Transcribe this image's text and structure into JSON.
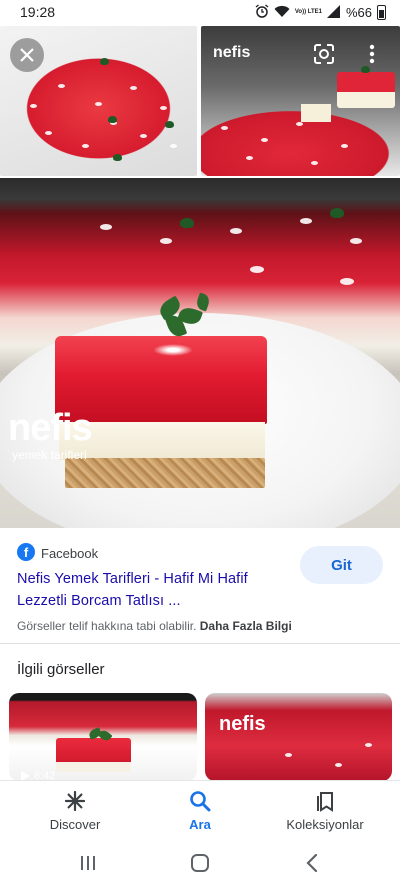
{
  "status_bar": {
    "time": "19:28",
    "network": "Vo)) LTE1",
    "battery": "%66"
  },
  "viewer": {
    "close_icon": "close-icon",
    "lens_icon": "google-lens-icon",
    "more_icon": "more-vert-icon",
    "watermark_brand": "nefis",
    "watermark_sub": "yemek tarifleri",
    "thumb_watermark": "nefis"
  },
  "result": {
    "source_name": "Facebook",
    "source_icon": "facebook-icon",
    "title": "Nefis Yemek Tarifleri - Hafif Mi Hafif Lezzetli Borcam Tatlısı ...",
    "visit_button": "Git",
    "copyright_text": "Görseller telif hakkına tabi olabilir.",
    "more_info_link": "Daha Fazla Bilgi"
  },
  "related": {
    "heading": "İlgili görseller",
    "items": [
      {
        "duration": "6:42",
        "icon": "play-icon"
      },
      {
        "watermark": "nefis"
      }
    ]
  },
  "bottom_nav": {
    "items": [
      {
        "label": "Discover",
        "icon": "discover-asterisk-icon"
      },
      {
        "label": "Ara",
        "icon": "search-icon"
      },
      {
        "label": "Koleksiyonlar",
        "icon": "collections-bookmark-icon"
      }
    ],
    "active_color": "#1a73e8"
  },
  "system_nav": {
    "recents_icon": "recents-icon",
    "home_icon": "home-icon",
    "back_icon": "back-icon"
  }
}
